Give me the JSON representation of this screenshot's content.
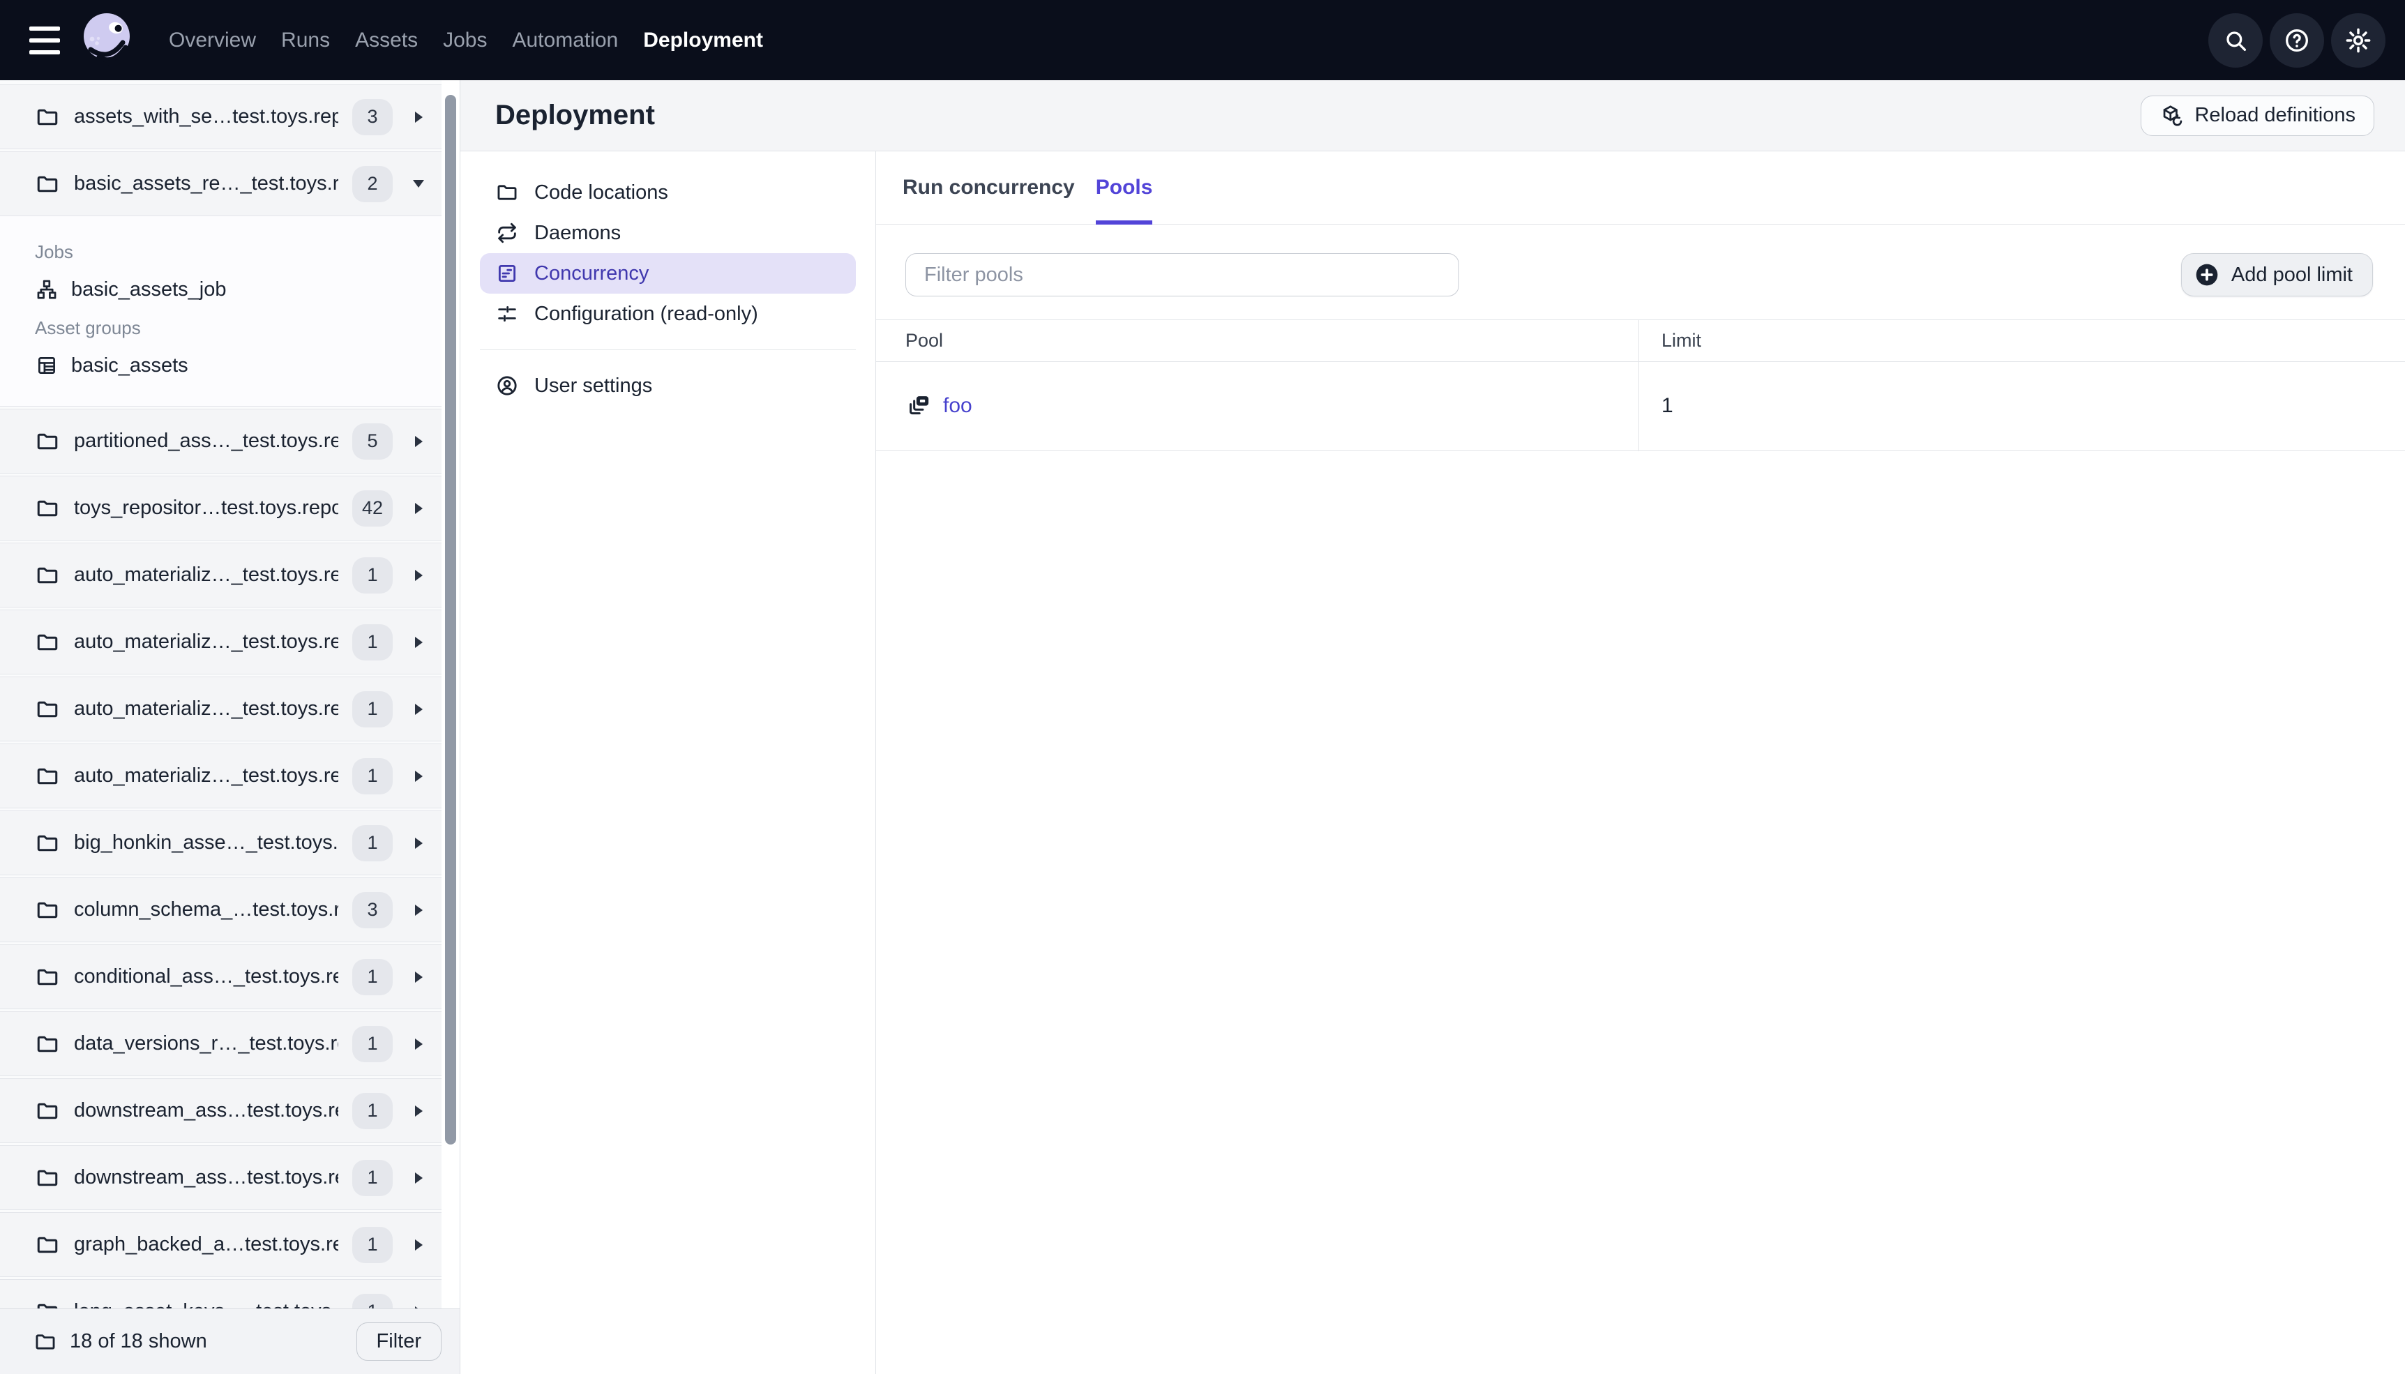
{
  "colors": {
    "topbar_bg": "#0a0e1b",
    "accent_indigo": "#5244d8",
    "link_indigo": "#4742cd",
    "subnav_selected_bg": "#e4e1f8",
    "subnav_selected_text": "#4038ae",
    "badge_bg": "#e5e7ec",
    "row_bg": "#f4f5f7",
    "logo_lavender": "#cfcbf0"
  },
  "topnav": {
    "menu_icon": "hamburger-icon",
    "logo_icon": "dagster-octopus-logo",
    "items": [
      {
        "label": "Overview",
        "active": false
      },
      {
        "label": "Runs",
        "active": false
      },
      {
        "label": "Assets",
        "active": false
      },
      {
        "label": "Jobs",
        "active": false
      },
      {
        "label": "Automation",
        "active": false
      },
      {
        "label": "Deployment",
        "active": true
      }
    ],
    "action_icons": [
      "search-icon",
      "help-icon",
      "settings-icon"
    ]
  },
  "sidebar": {
    "repos": [
      {
        "name": "assets_with_se…test.toys.repo",
        "count": "3",
        "state": "collapsed"
      },
      {
        "name": "basic_assets_re…_test.toys.rep",
        "count": "2",
        "state": "expanded",
        "sections": [
          {
            "label": "Jobs",
            "items": [
              {
                "icon": "job-icon",
                "label": "basic_assets_job"
              }
            ]
          },
          {
            "label": "Asset groups",
            "items": [
              {
                "icon": "asset-group-icon",
                "label": "basic_assets"
              }
            ]
          }
        ]
      },
      {
        "name": "partitioned_ass…_test.toys.rep",
        "count": "5",
        "state": "collapsed"
      },
      {
        "name": "toys_repositor…test.toys.repo",
        "count": "42",
        "state": "collapsed"
      },
      {
        "name": "auto_materializ…_test.toys.repo",
        "count": "1",
        "state": "collapsed"
      },
      {
        "name": "auto_materializ…_test.toys.repo",
        "count": "1",
        "state": "collapsed"
      },
      {
        "name": "auto_materializ…_test.toys.repo",
        "count": "1",
        "state": "collapsed"
      },
      {
        "name": "auto_materializ…_test.toys.repo",
        "count": "1",
        "state": "collapsed"
      },
      {
        "name": "big_honkin_asse…_test.toys.rep",
        "count": "1",
        "state": "collapsed"
      },
      {
        "name": "column_schema_…test.toys.rep",
        "count": "3",
        "state": "collapsed"
      },
      {
        "name": "conditional_ass…_test.toys.repo",
        "count": "1",
        "state": "collapsed"
      },
      {
        "name": "data_versions_r…_test.toys.rep",
        "count": "1",
        "state": "collapsed"
      },
      {
        "name": "downstream_ass…test.toys.rep",
        "count": "1",
        "state": "collapsed"
      },
      {
        "name": "downstream_ass…test.toys.rep",
        "count": "1",
        "state": "collapsed"
      },
      {
        "name": "graph_backed_a…test.toys.repo",
        "count": "1",
        "state": "collapsed"
      },
      {
        "name": "long_asset_keys…_test.toys.rep",
        "count": "1",
        "state": "collapsed"
      }
    ],
    "footer": {
      "summary": "18 of 18 shown",
      "filter_label": "Filter"
    }
  },
  "header": {
    "title": "Deployment",
    "reload_label": "Reload definitions"
  },
  "subnav": {
    "items": [
      {
        "icon": "folder-icon",
        "label": "Code locations",
        "selected": false
      },
      {
        "icon": "daemons-icon",
        "label": "Daemons",
        "selected": false
      },
      {
        "icon": "concurrency-icon",
        "label": "Concurrency",
        "selected": true
      },
      {
        "icon": "sliders-icon",
        "label": "Configuration (read-only)",
        "selected": false
      },
      {
        "icon": "user-icon",
        "label": "User settings",
        "selected": false
      }
    ]
  },
  "main": {
    "tabs": [
      {
        "label": "Run concurrency",
        "active": false
      },
      {
        "label": "Pools",
        "active": true
      }
    ],
    "filter_placeholder": "Filter pools",
    "add_pool_label": "Add pool limit",
    "table": {
      "columns": [
        "Pool",
        "Limit"
      ],
      "rows": [
        {
          "pool": "foo",
          "limit": "1"
        }
      ]
    }
  }
}
